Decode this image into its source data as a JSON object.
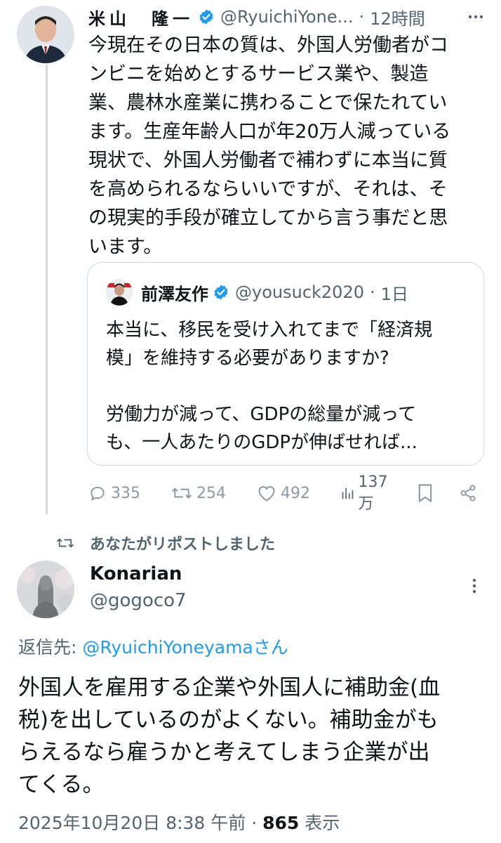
{
  "tweet1": {
    "name": "米山　隆一",
    "handle": "@RyuichiYone...",
    "separator": "·",
    "time": "12時間",
    "body_lines": [
      "今現在その日本の質は、外国人労働者がコ",
      "ンビニを始めとするサービス業や、製造",
      "業、農林水産業に携わることで保たれてい",
      "ます。生産年齢人口が年20万人減っている",
      "現状で、外国人労働者で補わずに本当に質",
      "を高められるならいいですが、それは、そ",
      "の現実的手段が確立してから言う事だと思",
      "います。"
    ],
    "quote": {
      "name": "前澤友作",
      "handle": "@yousuck2020",
      "separator": "·",
      "time": "1日",
      "body_lines_1": [
        "本当に、移民を受け入れてまで「経済規",
        "模」を維持する必要がありますか?"
      ],
      "body_lines_2": [
        "労働力が減って、GDPの総量が減って",
        "も、一人あたりのGDPが伸ばせれば..."
      ]
    },
    "actions": {
      "replies": "335",
      "reposts": "254",
      "likes": "492",
      "views": "137万"
    }
  },
  "repost_note": "あなたがリポストしました",
  "tweet2": {
    "name": "Konarian",
    "handle": "@gogoco7",
    "reply_prefix": "返信先: ",
    "reply_mention": "@RyuichiYoneyamaさん",
    "body_lines": [
      "外国人を雇用する企業や外国人に補助金(血",
      "税)を出しているのがよくない。補助金がも",
      "らえるなら雇うかと考えてしまう企業が出",
      "てくる。"
    ],
    "timestamp": "2025年10月20日 8:38 午前",
    "meta_separator": " · ",
    "view_count": "865",
    "view_label": " 表示"
  },
  "colors": {
    "text": "#0f1419",
    "secondary": "#536471",
    "link": "#1d9bf0",
    "verified": "#1d9bf0",
    "border": "#cfd9de"
  }
}
